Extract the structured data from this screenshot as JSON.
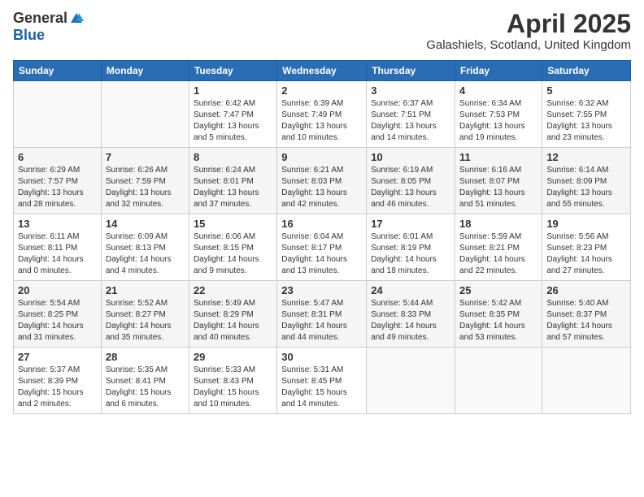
{
  "logo": {
    "general": "General",
    "blue": "Blue"
  },
  "header": {
    "title": "April 2025",
    "subtitle": "Galashiels, Scotland, United Kingdom"
  },
  "weekdays": [
    "Sunday",
    "Monday",
    "Tuesday",
    "Wednesday",
    "Thursday",
    "Friday",
    "Saturday"
  ],
  "weeks": [
    [
      {
        "day": "",
        "info": ""
      },
      {
        "day": "",
        "info": ""
      },
      {
        "day": "1",
        "info": "Sunrise: 6:42 AM\nSunset: 7:47 PM\nDaylight: 13 hours and 5 minutes."
      },
      {
        "day": "2",
        "info": "Sunrise: 6:39 AM\nSunset: 7:49 PM\nDaylight: 13 hours and 10 minutes."
      },
      {
        "day": "3",
        "info": "Sunrise: 6:37 AM\nSunset: 7:51 PM\nDaylight: 13 hours and 14 minutes."
      },
      {
        "day": "4",
        "info": "Sunrise: 6:34 AM\nSunset: 7:53 PM\nDaylight: 13 hours and 19 minutes."
      },
      {
        "day": "5",
        "info": "Sunrise: 6:32 AM\nSunset: 7:55 PM\nDaylight: 13 hours and 23 minutes."
      }
    ],
    [
      {
        "day": "6",
        "info": "Sunrise: 6:29 AM\nSunset: 7:57 PM\nDaylight: 13 hours and 28 minutes."
      },
      {
        "day": "7",
        "info": "Sunrise: 6:26 AM\nSunset: 7:59 PM\nDaylight: 13 hours and 32 minutes."
      },
      {
        "day": "8",
        "info": "Sunrise: 6:24 AM\nSunset: 8:01 PM\nDaylight: 13 hours and 37 minutes."
      },
      {
        "day": "9",
        "info": "Sunrise: 6:21 AM\nSunset: 8:03 PM\nDaylight: 13 hours and 42 minutes."
      },
      {
        "day": "10",
        "info": "Sunrise: 6:19 AM\nSunset: 8:05 PM\nDaylight: 13 hours and 46 minutes."
      },
      {
        "day": "11",
        "info": "Sunrise: 6:16 AM\nSunset: 8:07 PM\nDaylight: 13 hours and 51 minutes."
      },
      {
        "day": "12",
        "info": "Sunrise: 6:14 AM\nSunset: 8:09 PM\nDaylight: 13 hours and 55 minutes."
      }
    ],
    [
      {
        "day": "13",
        "info": "Sunrise: 6:11 AM\nSunset: 8:11 PM\nDaylight: 14 hours and 0 minutes."
      },
      {
        "day": "14",
        "info": "Sunrise: 6:09 AM\nSunset: 8:13 PM\nDaylight: 14 hours and 4 minutes."
      },
      {
        "day": "15",
        "info": "Sunrise: 6:06 AM\nSunset: 8:15 PM\nDaylight: 14 hours and 9 minutes."
      },
      {
        "day": "16",
        "info": "Sunrise: 6:04 AM\nSunset: 8:17 PM\nDaylight: 14 hours and 13 minutes."
      },
      {
        "day": "17",
        "info": "Sunrise: 6:01 AM\nSunset: 8:19 PM\nDaylight: 14 hours and 18 minutes."
      },
      {
        "day": "18",
        "info": "Sunrise: 5:59 AM\nSunset: 8:21 PM\nDaylight: 14 hours and 22 minutes."
      },
      {
        "day": "19",
        "info": "Sunrise: 5:56 AM\nSunset: 8:23 PM\nDaylight: 14 hours and 27 minutes."
      }
    ],
    [
      {
        "day": "20",
        "info": "Sunrise: 5:54 AM\nSunset: 8:25 PM\nDaylight: 14 hours and 31 minutes."
      },
      {
        "day": "21",
        "info": "Sunrise: 5:52 AM\nSunset: 8:27 PM\nDaylight: 14 hours and 35 minutes."
      },
      {
        "day": "22",
        "info": "Sunrise: 5:49 AM\nSunset: 8:29 PM\nDaylight: 14 hours and 40 minutes."
      },
      {
        "day": "23",
        "info": "Sunrise: 5:47 AM\nSunset: 8:31 PM\nDaylight: 14 hours and 44 minutes."
      },
      {
        "day": "24",
        "info": "Sunrise: 5:44 AM\nSunset: 8:33 PM\nDaylight: 14 hours and 49 minutes."
      },
      {
        "day": "25",
        "info": "Sunrise: 5:42 AM\nSunset: 8:35 PM\nDaylight: 14 hours and 53 minutes."
      },
      {
        "day": "26",
        "info": "Sunrise: 5:40 AM\nSunset: 8:37 PM\nDaylight: 14 hours and 57 minutes."
      }
    ],
    [
      {
        "day": "27",
        "info": "Sunrise: 5:37 AM\nSunset: 8:39 PM\nDaylight: 15 hours and 2 minutes."
      },
      {
        "day": "28",
        "info": "Sunrise: 5:35 AM\nSunset: 8:41 PM\nDaylight: 15 hours and 6 minutes."
      },
      {
        "day": "29",
        "info": "Sunrise: 5:33 AM\nSunset: 8:43 PM\nDaylight: 15 hours and 10 minutes."
      },
      {
        "day": "30",
        "info": "Sunrise: 5:31 AM\nSunset: 8:45 PM\nDaylight: 15 hours and 14 minutes."
      },
      {
        "day": "",
        "info": ""
      },
      {
        "day": "",
        "info": ""
      },
      {
        "day": "",
        "info": ""
      }
    ]
  ]
}
